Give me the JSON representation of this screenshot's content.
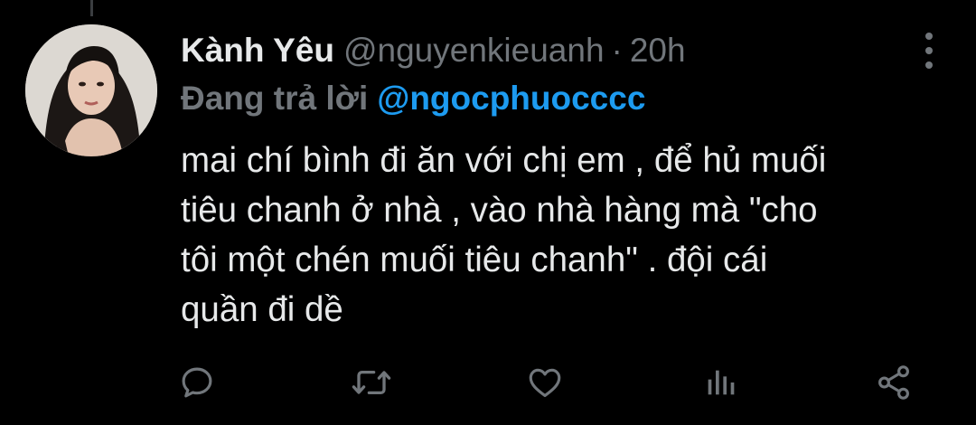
{
  "tweet": {
    "author": {
      "display_name": "Kành Yêu",
      "handle": "@nguyenkieuanh",
      "avatar_icon": "avatar-photo"
    },
    "separator": "·",
    "time": "20h",
    "reply": {
      "prefix": "Đang trả lời",
      "handle": "@ngocphuocccc"
    },
    "body": "mai chí bình đi ăn với chị em , để hủ muối\ntiêu chanh ở nhà , vào nhà hàng mà \"cho\ntôi một chén muối tiêu chanh\" . đội cái\nquần đi dề"
  },
  "actions": [
    {
      "icon": "reply-icon"
    },
    {
      "icon": "retweet-icon"
    },
    {
      "icon": "like-icon"
    },
    {
      "icon": "analytics-icon"
    },
    {
      "icon": "share-icon"
    }
  ],
  "colors": {
    "background": "#000000",
    "text_primary": "#e7e9ea",
    "text_secondary": "#71767b",
    "accent": "#1d9bf0"
  }
}
